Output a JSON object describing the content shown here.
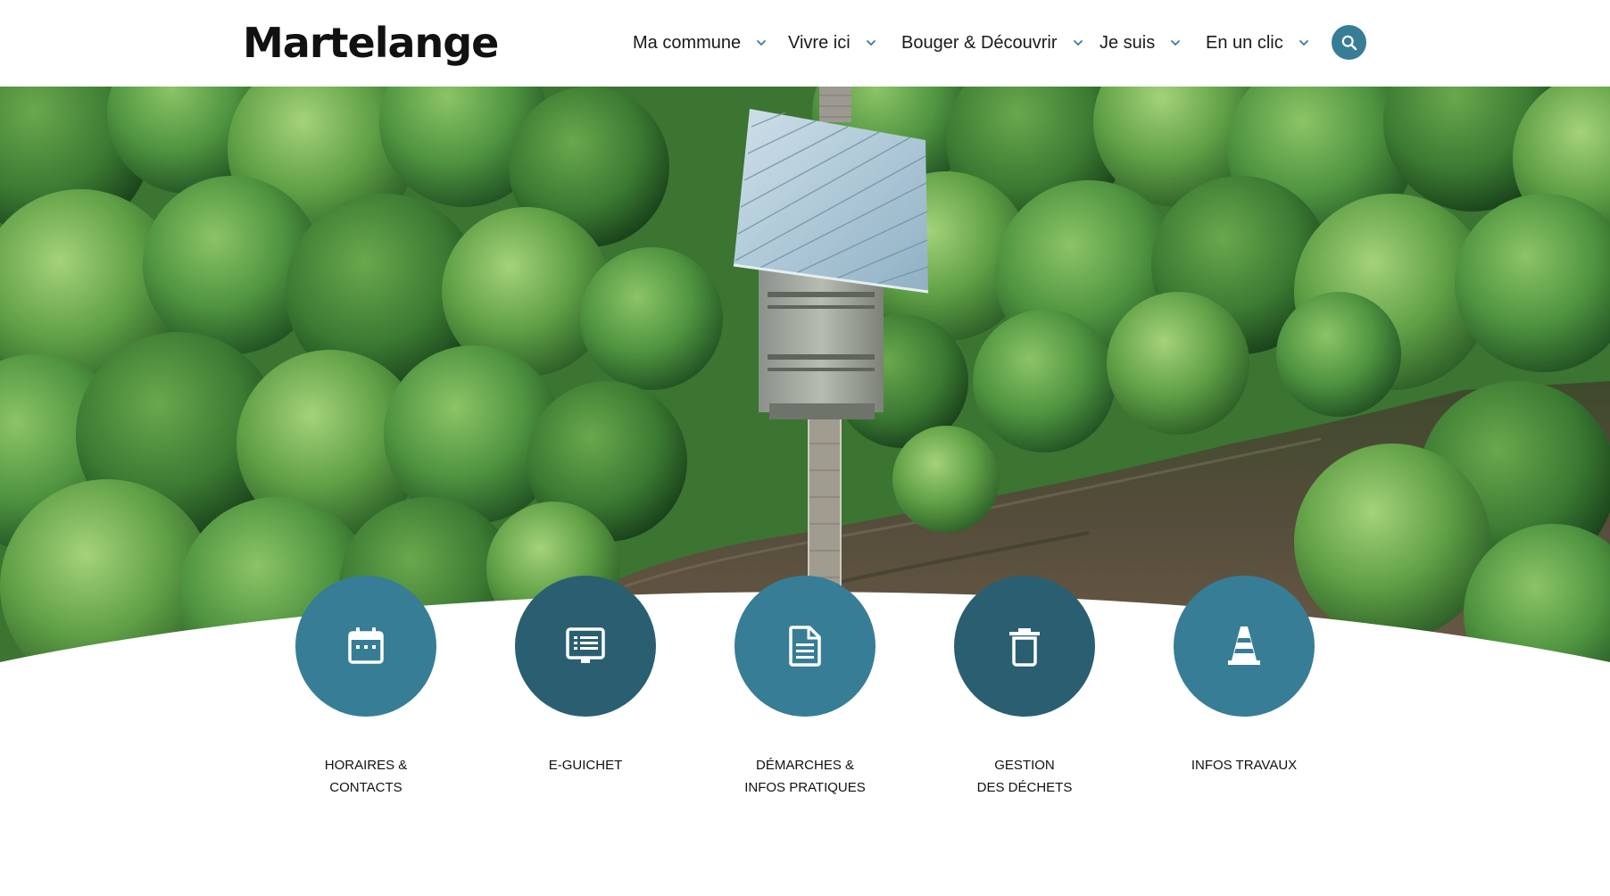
{
  "brand": {
    "name": "Martelange"
  },
  "nav": {
    "items": [
      {
        "label": "Ma commune"
      },
      {
        "label": "Vivre ici"
      },
      {
        "label": "Bouger & Découvrir"
      },
      {
        "label": "Je suis"
      },
      {
        "label": "En un clic"
      }
    ],
    "search_icon": "search-icon"
  },
  "quick_links": [
    {
      "lines": [
        "HORAIRES &",
        "CONTACTS"
      ],
      "icon": "calendar-icon"
    },
    {
      "lines": [
        "E-GUICHET",
        ""
      ],
      "icon": "monitor-icon"
    },
    {
      "lines": [
        "DÉMARCHES &",
        "INFOS PRATIQUES"
      ],
      "icon": "document-icon"
    },
    {
      "lines": [
        "GESTION",
        "DES DÉCHETS"
      ],
      "icon": "trash-icon"
    },
    {
      "lines": [
        "INFOS TRAVAUX",
        ""
      ],
      "icon": "traffic-cone-icon"
    }
  ],
  "colors": {
    "accent": "#377d96",
    "accent_dark": "#2a5f72",
    "text": "#111111",
    "forest": "#4c8a3c",
    "river": "#4a4538"
  }
}
